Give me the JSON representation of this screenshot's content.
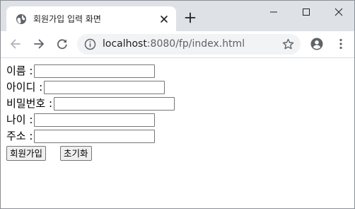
{
  "browser": {
    "tab_title": "회원가입 입력 화면",
    "url_host": "localhost",
    "url_path": ":8080/fp/index.html",
    "icons": {
      "favicon": "globe-icon",
      "tab_close": "close-icon",
      "new_tab": "plus-icon",
      "minimize": "minimize-icon",
      "maximize": "maximize-icon",
      "close_window": "close-window-icon",
      "back": "back-arrow-icon",
      "forward": "forward-arrow-icon",
      "reload": "reload-icon",
      "site_info": "info-icon",
      "bookmark": "star-icon",
      "profile": "account-icon",
      "menu": "kebab-menu-icon"
    },
    "colors": {
      "tabstrip": "#dee1e6",
      "omnibox": "#f1f3f4"
    }
  },
  "form": {
    "fields": [
      {
        "label": "이름 :",
        "value": ""
      },
      {
        "label": "아이디 :",
        "value": ""
      },
      {
        "label": "비밀번호 :",
        "value": ""
      },
      {
        "label": "나이 :",
        "value": ""
      },
      {
        "label": "주소 :",
        "value": ""
      }
    ],
    "submit_label": "회원가입",
    "reset_label": "초기화"
  }
}
